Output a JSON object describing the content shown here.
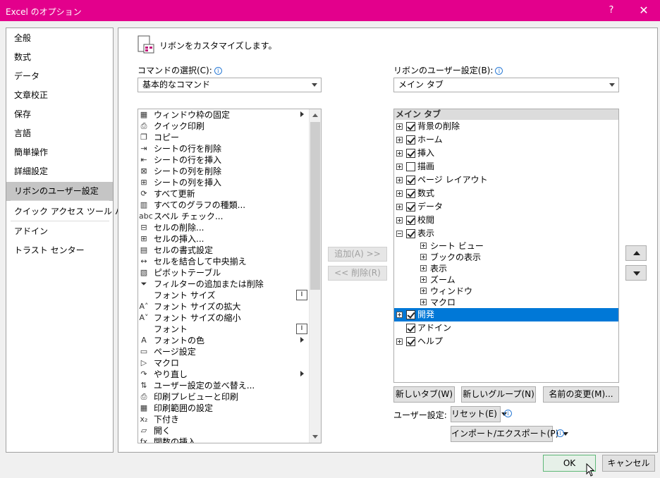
{
  "window": {
    "title": "Excel のオプション",
    "help": "?",
    "close": "✕",
    "titlebar_color": "#e3008c"
  },
  "nav": {
    "items": [
      {
        "label": "全般"
      },
      {
        "label": "数式"
      },
      {
        "label": "データ"
      },
      {
        "label": "文章校正"
      },
      {
        "label": "保存"
      },
      {
        "label": "言語"
      },
      {
        "label": "簡単操作"
      },
      {
        "label": "詳細設定"
      },
      {
        "label": "リボンのユーザー設定",
        "selected": true
      },
      {
        "label": "クイック アクセス ツール バー"
      },
      {
        "label": "アドイン"
      },
      {
        "label": "トラスト センター"
      }
    ]
  },
  "main": {
    "header": "リボンをカスタマイズします。",
    "choose_label": "コマンドの選択(C):",
    "choose_value": "基本的なコマンド",
    "customize_label": "リボンのユーザー設定(B):",
    "customize_value": "メイン タブ",
    "commands": [
      {
        "label": "ウィンドウ枠の固定",
        "icon": "▦",
        "submenu": true
      },
      {
        "label": "クイック印刷",
        "icon": "⎙"
      },
      {
        "label": "コピー",
        "icon": "❐"
      },
      {
        "label": "シートの行を削除",
        "icon": "⇥"
      },
      {
        "label": "シートの行を挿入",
        "icon": "⇤"
      },
      {
        "label": "シートの列を削除",
        "icon": "⊠"
      },
      {
        "label": "シートの列を挿入",
        "icon": "⊞"
      },
      {
        "label": "すべて更新",
        "icon": "⟳"
      },
      {
        "label": "すべてのグラフの種類...",
        "icon": "▥"
      },
      {
        "label": "スペル チェック...",
        "icon": "abc"
      },
      {
        "label": "セルの削除...",
        "icon": "⊟"
      },
      {
        "label": "セルの挿入...",
        "icon": "⊞"
      },
      {
        "label": "セルの書式設定",
        "icon": "▤"
      },
      {
        "label": "セルを結合して中央揃え",
        "icon": "↔"
      },
      {
        "label": "ピボットテーブル",
        "icon": "▧"
      },
      {
        "label": "フィルターの追加または削除",
        "icon": "⏷"
      },
      {
        "label": "フォント サイズ",
        "icon": "",
        "box": "I"
      },
      {
        "label": "フォント サイズの拡大",
        "icon": "A˄"
      },
      {
        "label": "フォント サイズの縮小",
        "icon": "A˅"
      },
      {
        "label": "フォント",
        "icon": "",
        "box": "I"
      },
      {
        "label": "フォントの色",
        "icon": "A",
        "submenu": true
      },
      {
        "label": "ページ設定",
        "icon": "▭"
      },
      {
        "label": "マクロ",
        "icon": "▷"
      },
      {
        "label": "やり直し",
        "icon": "↷",
        "submenu": true
      },
      {
        "label": "ユーザー設定の並べ替え...",
        "icon": "⇅"
      },
      {
        "label": "印刷プレビューと印刷",
        "icon": "⎙"
      },
      {
        "label": "印刷範囲の設定",
        "icon": "▦"
      },
      {
        "label": "下付き",
        "icon": "x₂"
      },
      {
        "label": "開く",
        "icon": "▱"
      },
      {
        "label": "関数の挿入",
        "icon": "fx"
      }
    ],
    "add_button": "追加(A) >>",
    "remove_button": "<< 削除(R)",
    "tree_header": "メイン タブ",
    "tree": [
      {
        "label": "背景の削除",
        "checked": true,
        "expander": "plus"
      },
      {
        "label": "ホーム",
        "checked": true,
        "expander": "plus"
      },
      {
        "label": "挿入",
        "checked": true,
        "expander": "plus"
      },
      {
        "label": "描画",
        "checked": false,
        "expander": "plus"
      },
      {
        "label": "ページ レイアウト",
        "checked": true,
        "expander": "plus"
      },
      {
        "label": "数式",
        "checked": true,
        "expander": "plus"
      },
      {
        "label": "データ",
        "checked": true,
        "expander": "plus"
      },
      {
        "label": "校閲",
        "checked": true,
        "expander": "plus"
      },
      {
        "label": "表示",
        "checked": true,
        "expander": "minus"
      },
      {
        "label": "シート ビュー",
        "sub": true
      },
      {
        "label": "ブックの表示",
        "sub": true
      },
      {
        "label": "表示",
        "sub": true
      },
      {
        "label": "ズーム",
        "sub": true
      },
      {
        "label": "ウィンドウ",
        "sub": true
      },
      {
        "label": "マクロ",
        "sub": true
      },
      {
        "label": "開発",
        "checked": true,
        "expander": "plus",
        "selected": true
      },
      {
        "label": "アドイン",
        "checked": true
      },
      {
        "label": "ヘルプ",
        "checked": true,
        "expander": "plus"
      }
    ],
    "new_tab": "新しいタブ(W)",
    "new_group": "新しいグループ(N)",
    "rename": "名前の変更(M)...",
    "user_settings_label": "ユーザー設定:",
    "reset_button": "リセット(E)",
    "import_export_button": "インポート/エクスポート(P)"
  },
  "footer": {
    "ok": "OK",
    "cancel": "キャンセル"
  }
}
